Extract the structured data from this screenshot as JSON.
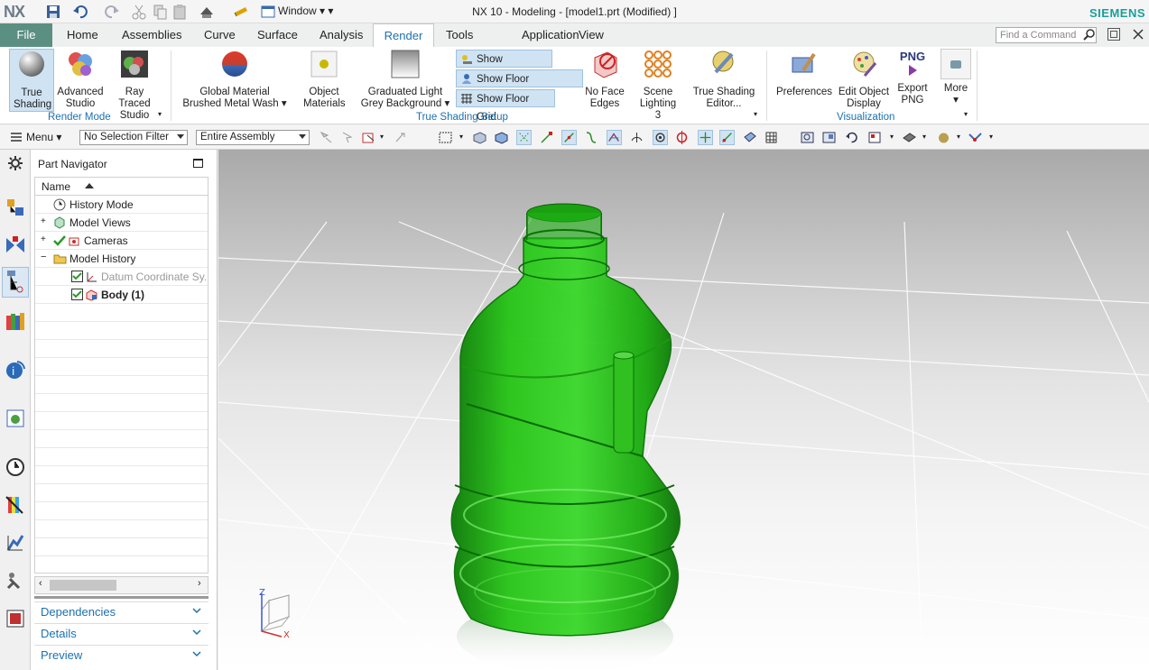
{
  "window": {
    "logo": "NX",
    "menu_label": "Window",
    "title": "NX 10 - Modeling - [model1.prt (Modified) ]",
    "brand": "SIEMENS"
  },
  "tabs": {
    "file": "File",
    "items": [
      "Home",
      "Assemblies",
      "Curve",
      "Surface",
      "Analysis",
      "Render",
      "Tools",
      "Application",
      "View"
    ],
    "active": "Render"
  },
  "search": {
    "placeholder": "Find a Command"
  },
  "ribbon": {
    "true_shading": "True Shading",
    "advanced_studio": "Advanced Studio",
    "ray_traced_studio": "Ray Traced Studio",
    "render_mode_group": "Render Mode",
    "global_material": "Global Material",
    "brushed_metal_wash": "Brushed Metal Wash",
    "object_materials": "Object Materials",
    "graduated_light": "Graduated Light",
    "grey_background": "Grey Background",
    "show_shadows": "Show Shadows",
    "show_floor_reflection": "Show Floor Reflection",
    "show_floor_grid": "Show Floor Grid",
    "true_shading_setup_group": "True Shading Setup",
    "no_face_edges": "No Face Edges",
    "scene_lighting": "Scene Lighting 3",
    "true_shading_editor": "True Shading Editor...",
    "preferences": "Preferences",
    "edit_object_display": "Edit Object Display",
    "export_png": "Export PNG",
    "png_label": "PNG",
    "more": "More",
    "visualization_group": "Visualization"
  },
  "toolbar": {
    "menu": "Menu",
    "selection_filter": "No Selection Filter",
    "assembly_scope": "Entire Assembly"
  },
  "navigator": {
    "title": "Part Navigator",
    "column_name": "Name",
    "items": [
      {
        "label": "History Mode",
        "icon": "clock-icon"
      },
      {
        "label": "Model Views",
        "icon": "views-icon"
      },
      {
        "label": "Cameras",
        "icon": "camera-icon"
      },
      {
        "label": "Model History",
        "icon": "folder-icon"
      },
      {
        "label": "Datum Coordinate Sy...",
        "icon": "datum-csys-icon"
      },
      {
        "label": "Body (1)",
        "icon": "body-icon"
      }
    ],
    "panels": [
      "Dependencies",
      "Details",
      "Preview"
    ]
  },
  "viewport": {
    "model_color": "#22cc11",
    "triad": {
      "z": "Z",
      "x": "X"
    }
  },
  "colors": {
    "accent": "#1c70b0",
    "file_tab": "#5b8f82",
    "brand": "#1a9e9c"
  }
}
